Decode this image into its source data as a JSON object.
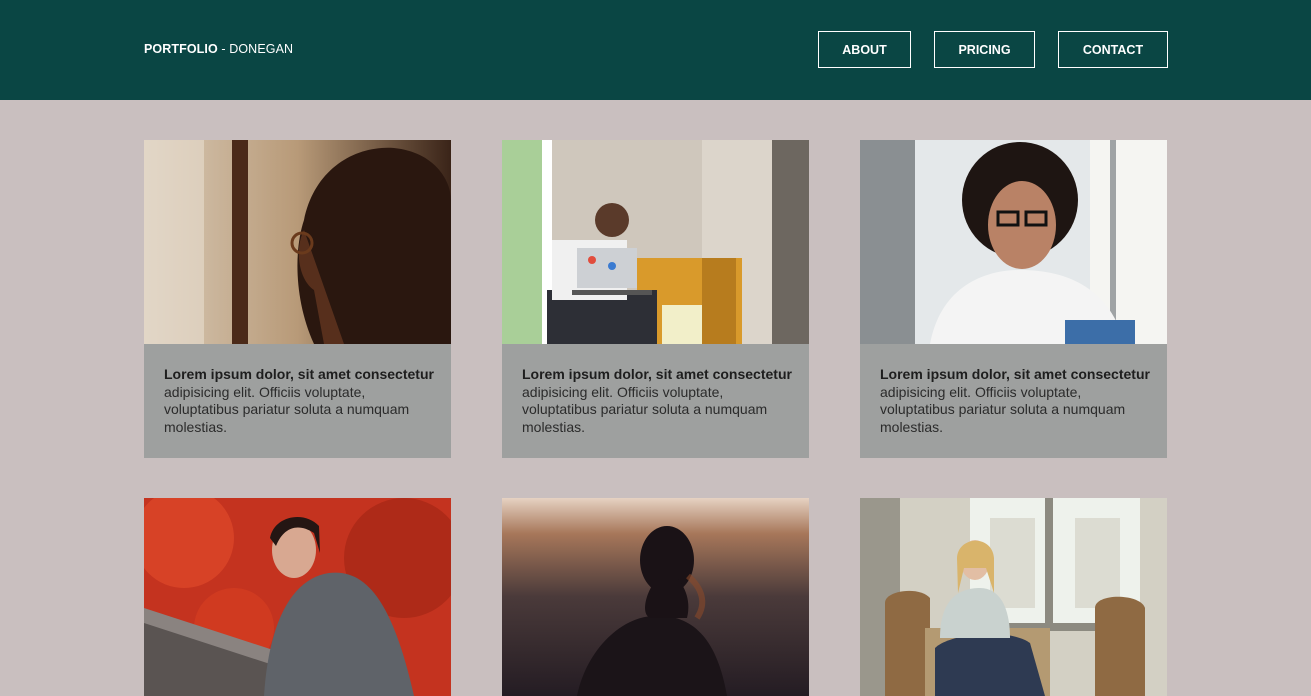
{
  "header": {
    "brand_bold": "PORTFOLIO",
    "brand_rest": " - DONEGAN",
    "nav": [
      "ABOUT",
      "PRICING",
      "CONTACT"
    ]
  },
  "cards": [
    {
      "lead": "Lorem ipsum dolor, sit amet consectetur",
      "body": "adipisicing elit. Officiis voluptate, voluptatibus pariatur soluta a numquam molestias.",
      "image": "woman-glasses-profile-window-photo"
    },
    {
      "lead": "Lorem ipsum dolor, sit amet consectetur",
      "body": "adipisicing elit. Officiis voluptate, voluptatibus pariatur soluta a numquam molestias.",
      "image": "man-laptop-stressed-office-photo"
    },
    {
      "lead": "Lorem ipsum dolor, sit amet consectetur",
      "body": "adipisicing elit. Officiis voluptate, voluptatibus pariatur soluta a numquam molestias.",
      "image": "woman-curly-hair-glasses-notebook-photo"
    },
    {
      "lead": "",
      "body": "",
      "image": "woman-smiling-red-foliage-photo"
    },
    {
      "lead": "",
      "body": "",
      "image": "woman-silhouette-sunset-photo"
    },
    {
      "lead": "",
      "body": "",
      "image": "woman-armchair-window-photo"
    }
  ],
  "colors": {
    "header_bg": "#0a4644",
    "page_bg": "#c9bfbf",
    "card_bg": "#9ea09f"
  }
}
